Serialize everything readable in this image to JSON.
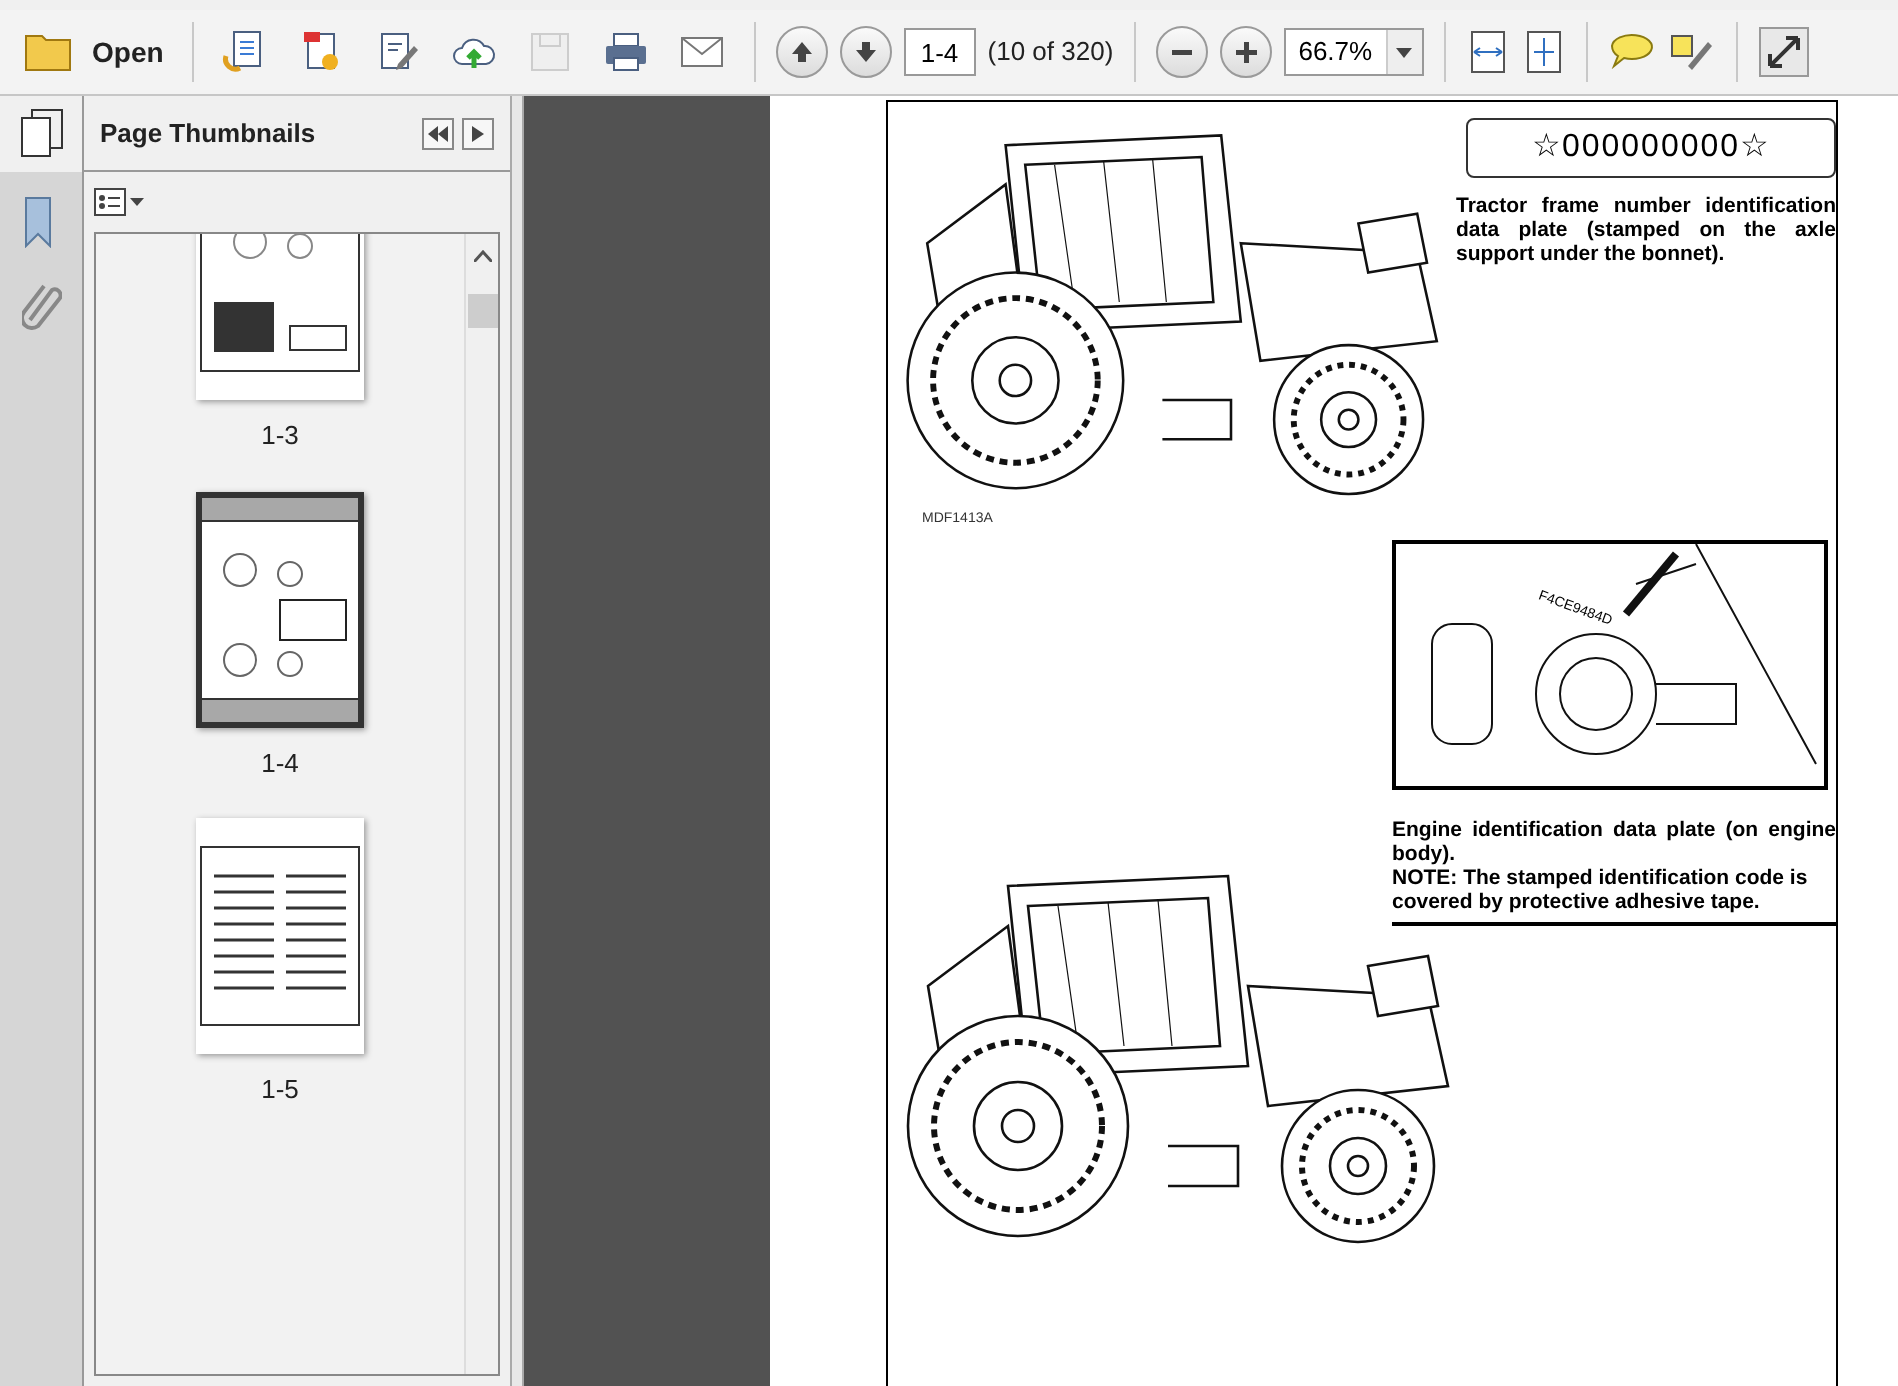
{
  "toolbar": {
    "open_label": "Open",
    "tools": [
      {
        "kind": "convert",
        "disabled": false
      },
      {
        "kind": "create",
        "disabled": false
      },
      {
        "kind": "edit",
        "disabled": false
      },
      {
        "kind": "upload",
        "disabled": false
      },
      {
        "kind": "save",
        "disabled": true
      },
      {
        "kind": "print",
        "disabled": false
      },
      {
        "kind": "email",
        "disabled": false
      }
    ],
    "page_field": "1-4",
    "page_count": "(10 of 320)",
    "zoom_field": "66.7%"
  },
  "sidebar": {
    "title": "Page Thumbnails",
    "thumbnails": [
      {
        "label": "1-3",
        "selected": false,
        "kind": "diagram"
      },
      {
        "label": "1-4",
        "selected": true,
        "kind": "tractor"
      },
      {
        "label": "1-5",
        "selected": false,
        "kind": "text"
      }
    ]
  },
  "document": {
    "serial": "☆000000000☆",
    "frame_caption": "Tractor frame number identification data plate (stamped on the axle support under the bonnet).",
    "figure_code": "MDF1413A",
    "engine_label": "F4CE9484D",
    "engine_caption": "Engine identification data plate (on engine body).",
    "engine_note": "NOTE: The stamped identification code is covered by protective adhesive tape."
  }
}
